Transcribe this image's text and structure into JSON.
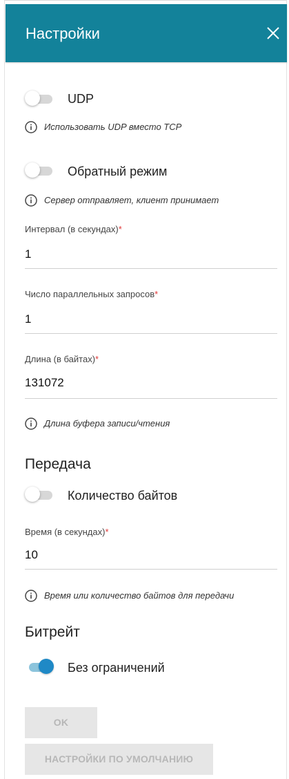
{
  "header": {
    "title": "Настройки",
    "close_icon": "close-icon",
    "color": "#13829a"
  },
  "udp": {
    "label": "UDP",
    "enabled": false,
    "hint": "Использовать UDP вместо TCP"
  },
  "reverse": {
    "label": "Обратный режим",
    "enabled": false,
    "hint": "Сервер отправляет, клиент принимает"
  },
  "fields": {
    "interval": {
      "label": "Интервал (в секундах)",
      "required": "*",
      "value": "1"
    },
    "parallel": {
      "label": "Число параллельных запросов",
      "required": "*",
      "value": "1"
    },
    "length": {
      "label": "Длина (в байтах)",
      "required": "*",
      "value": "131072",
      "hint": "Длина буфера записи/чтения"
    }
  },
  "transfer": {
    "title": "Передача",
    "bytes_toggle": {
      "label": "Количество байтов",
      "enabled": false
    },
    "time": {
      "label": "Время (в секундах)",
      "required": "*",
      "value": "10"
    },
    "hint": "Время или количество байтов для передачи"
  },
  "bitrate": {
    "title": "Битрейт",
    "unlimited_toggle": {
      "label": "Без ограничений",
      "enabled": true
    }
  },
  "buttons": {
    "ok": "OK",
    "defaults": "НАСТРОЙКИ ПО УМОЛЧАНИЮ"
  },
  "colors": {
    "accent": "#1f89c6",
    "required": "#e03a3a",
    "toggle_on_track": "#8cc4dc"
  }
}
